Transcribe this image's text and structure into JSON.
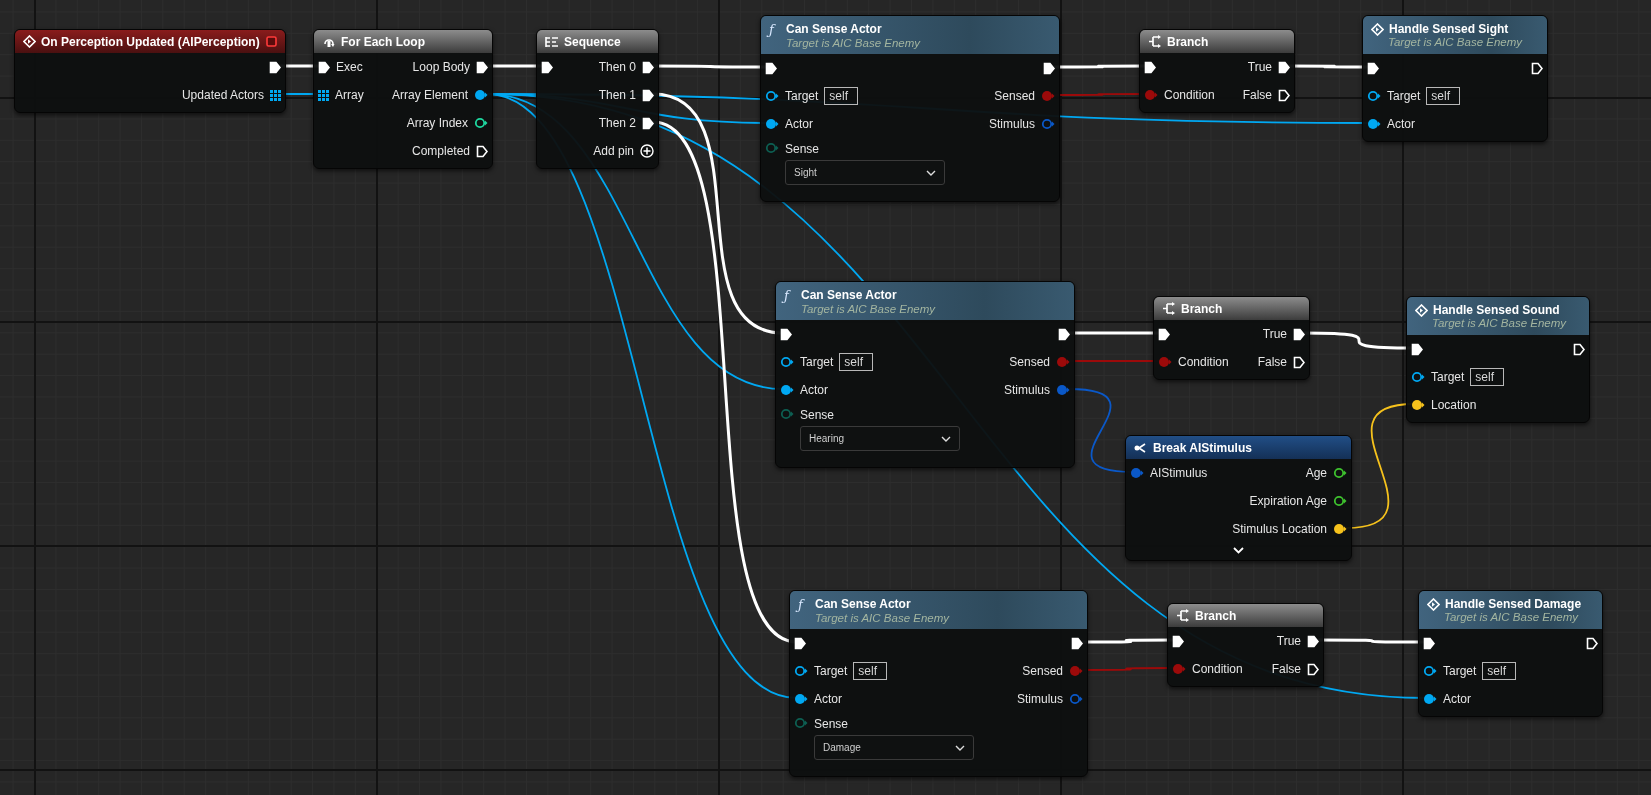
{
  "graph": {
    "nodes": [
      {
        "kind": "event",
        "title": "On Perception Updated (AIPerception)",
        "rows": [
          {
            "right": {
              "kind": "exec",
              "connected": true
            }
          },
          {
            "right": {
              "kind": "array",
              "label": "Updated Actors",
              "connected": true
            }
          }
        ]
      },
      {
        "kind": "macro",
        "title": "For Each Loop",
        "rows": [
          {
            "left": {
              "kind": "exec",
              "label": "Exec",
              "connected": true
            },
            "right": {
              "kind": "exec",
              "label": "Loop Body",
              "connected": true
            }
          },
          {
            "left": {
              "kind": "array",
              "label": "Array",
              "connected": true
            },
            "right": {
              "kind": "object",
              "label": "Array Element",
              "connected": true
            }
          },
          {
            "right": {
              "kind": "int",
              "label": "Array Index",
              "connected": false
            }
          },
          {
            "right": {
              "kind": "exec",
              "label": "Completed",
              "connected": false
            }
          }
        ]
      },
      {
        "kind": "sequence",
        "title": "Sequence",
        "rows": [
          {
            "left": {
              "kind": "exec",
              "connected": true
            },
            "right": {
              "kind": "exec",
              "label": "Then 0",
              "connected": true
            }
          },
          {
            "right": {
              "kind": "exec",
              "label": "Then 1",
              "connected": true
            }
          },
          {
            "right": {
              "kind": "exec",
              "label": "Then 2",
              "connected": true
            }
          },
          {
            "right": {
              "kind": "add",
              "label": "Add pin"
            }
          }
        ]
      },
      {
        "kind": "function",
        "icon": "ƒ",
        "title": "Can Sense Actor",
        "subtitle": "Target is AIC Base Enemy",
        "rows": [
          {
            "left": {
              "kind": "exec",
              "connected": true
            },
            "right": {
              "kind": "exec",
              "connected": true
            }
          },
          {
            "left": {
              "kind": "object",
              "label": "Target",
              "default": "self",
              "connected": false
            },
            "right": {
              "kind": "bool",
              "label": "Sensed",
              "connected": true
            }
          },
          {
            "left": {
              "kind": "object",
              "label": "Actor",
              "connected": true
            },
            "right": {
              "kind": "struct",
              "label": "Stimulus",
              "connected": false
            }
          },
          {
            "left": {
              "kind": "enum",
              "label": "Sense",
              "value": "Sight",
              "connected": false
            }
          }
        ]
      },
      {
        "kind": "branch",
        "title": "Branch",
        "rows": [
          {
            "left": {
              "kind": "exec",
              "connected": true
            },
            "right": {
              "kind": "exec",
              "label": "True",
              "connected": true
            }
          },
          {
            "left": {
              "kind": "bool",
              "label": "Condition",
              "connected": true
            },
            "right": {
              "kind": "exec",
              "label": "False",
              "connected": false
            }
          }
        ]
      },
      {
        "kind": "call",
        "title": "Handle Sensed Sight",
        "subtitle": "Target is AIC Base Enemy",
        "rows": [
          {
            "left": {
              "kind": "exec",
              "connected": true
            },
            "right": {
              "kind": "exec",
              "connected": false
            }
          },
          {
            "left": {
              "kind": "object",
              "label": "Target",
              "default": "self",
              "connected": false
            }
          },
          {
            "left": {
              "kind": "object",
              "label": "Actor",
              "connected": true
            }
          }
        ]
      },
      {
        "kind": "function",
        "icon": "ƒ",
        "title": "Can Sense Actor",
        "subtitle": "Target is AIC Base Enemy",
        "rows": [
          {
            "left": {
              "kind": "exec",
              "connected": true
            },
            "right": {
              "kind": "exec",
              "connected": true
            }
          },
          {
            "left": {
              "kind": "object",
              "label": "Target",
              "default": "self",
              "connected": false
            },
            "right": {
              "kind": "bool",
              "label": "Sensed",
              "connected": true
            }
          },
          {
            "left": {
              "kind": "object",
              "label": "Actor",
              "connected": true
            },
            "right": {
              "kind": "struct",
              "label": "Stimulus",
              "connected": true
            }
          },
          {
            "left": {
              "kind": "enum",
              "label": "Sense",
              "value": "Hearing",
              "connected": false
            }
          }
        ]
      },
      {
        "kind": "branch",
        "title": "Branch",
        "rows": [
          {
            "left": {
              "kind": "exec",
              "connected": true
            },
            "right": {
              "kind": "exec",
              "label": "True",
              "connected": true
            }
          },
          {
            "left": {
              "kind": "bool",
              "label": "Condition",
              "connected": true
            },
            "right": {
              "kind": "exec",
              "label": "False",
              "connected": false
            }
          }
        ]
      },
      {
        "kind": "call",
        "title": "Handle Sensed Sound",
        "subtitle": "Target is AIC Base Enemy",
        "rows": [
          {
            "left": {
              "kind": "exec",
              "connected": true
            },
            "right": {
              "kind": "exec",
              "connected": false
            }
          },
          {
            "left": {
              "kind": "object",
              "label": "Target",
              "default": "self",
              "connected": false
            }
          },
          {
            "left": {
              "kind": "vector",
              "label": "Location",
              "connected": true
            }
          }
        ]
      },
      {
        "kind": "break",
        "title": "Break AIStimulus",
        "expandable": true,
        "rows": [
          {
            "left": {
              "kind": "struct",
              "label": "AIStimulus",
              "connected": true
            },
            "right": {
              "kind": "float",
              "label": "Age",
              "connected": false
            }
          },
          {
            "right": {
              "kind": "float",
              "label": "Expiration Age",
              "connected": false
            }
          },
          {
            "right": {
              "kind": "vector",
              "label": "Stimulus Location",
              "connected": true
            }
          }
        ]
      },
      {
        "kind": "function",
        "icon": "ƒ",
        "title": "Can Sense Actor",
        "subtitle": "Target is AIC Base Enemy",
        "rows": [
          {
            "left": {
              "kind": "exec",
              "connected": true
            },
            "right": {
              "kind": "exec",
              "connected": true
            }
          },
          {
            "left": {
              "kind": "object",
              "label": "Target",
              "default": "self",
              "connected": false
            },
            "right": {
              "kind": "bool",
              "label": "Sensed",
              "connected": true
            }
          },
          {
            "left": {
              "kind": "object",
              "label": "Actor",
              "connected": true
            },
            "right": {
              "kind": "struct",
              "label": "Stimulus",
              "connected": false
            }
          },
          {
            "left": {
              "kind": "enum",
              "label": "Sense",
              "value": "Damage",
              "connected": false
            }
          }
        ]
      },
      {
        "kind": "branch",
        "title": "Branch",
        "rows": [
          {
            "left": {
              "kind": "exec",
              "connected": true
            },
            "right": {
              "kind": "exec",
              "label": "True",
              "connected": true
            }
          },
          {
            "left": {
              "kind": "bool",
              "label": "Condition",
              "connected": true
            },
            "right": {
              "kind": "exec",
              "label": "False",
              "connected": false
            }
          }
        ]
      },
      {
        "kind": "call",
        "title": "Handle Sensed Damage",
        "subtitle": "Target is AIC Base Enemy",
        "rows": [
          {
            "left": {
              "kind": "exec",
              "connected": true
            },
            "right": {
              "kind": "exec",
              "connected": false
            }
          },
          {
            "left": {
              "kind": "object",
              "label": "Target",
              "default": "self",
              "connected": false
            }
          },
          {
            "left": {
              "kind": "object",
              "label": "Actor",
              "connected": true
            }
          }
        ]
      }
    ]
  }
}
